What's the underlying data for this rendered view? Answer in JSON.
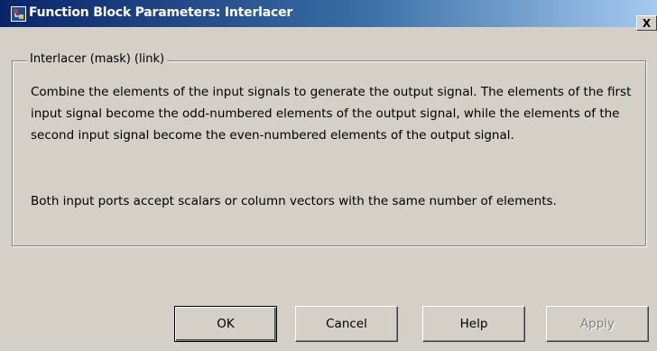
{
  "window": {
    "title": "Function Block Parameters: Interlacer",
    "close_label": "X"
  },
  "group": {
    "title": "Interlacer (mask) (link)",
    "description_1": "Combine the elements of the input signals to generate the output signal. The elements of the first input signal become the odd-numbered elements of the output signal, while the elements of the second input signal become the even-numbered elements of the output signal.",
    "description_2": "Both input ports accept scalars or column vectors with the same number of elements."
  },
  "buttons": {
    "ok": "OK",
    "cancel": "Cancel",
    "help": "Help",
    "apply": "Apply"
  },
  "icons": {
    "app": "simulink-block-icon",
    "close": "close-icon"
  },
  "colors": {
    "titlebar_start": "#0a246a",
    "titlebar_end": "#a6caf0",
    "window_bg": "#d4d0c8"
  }
}
